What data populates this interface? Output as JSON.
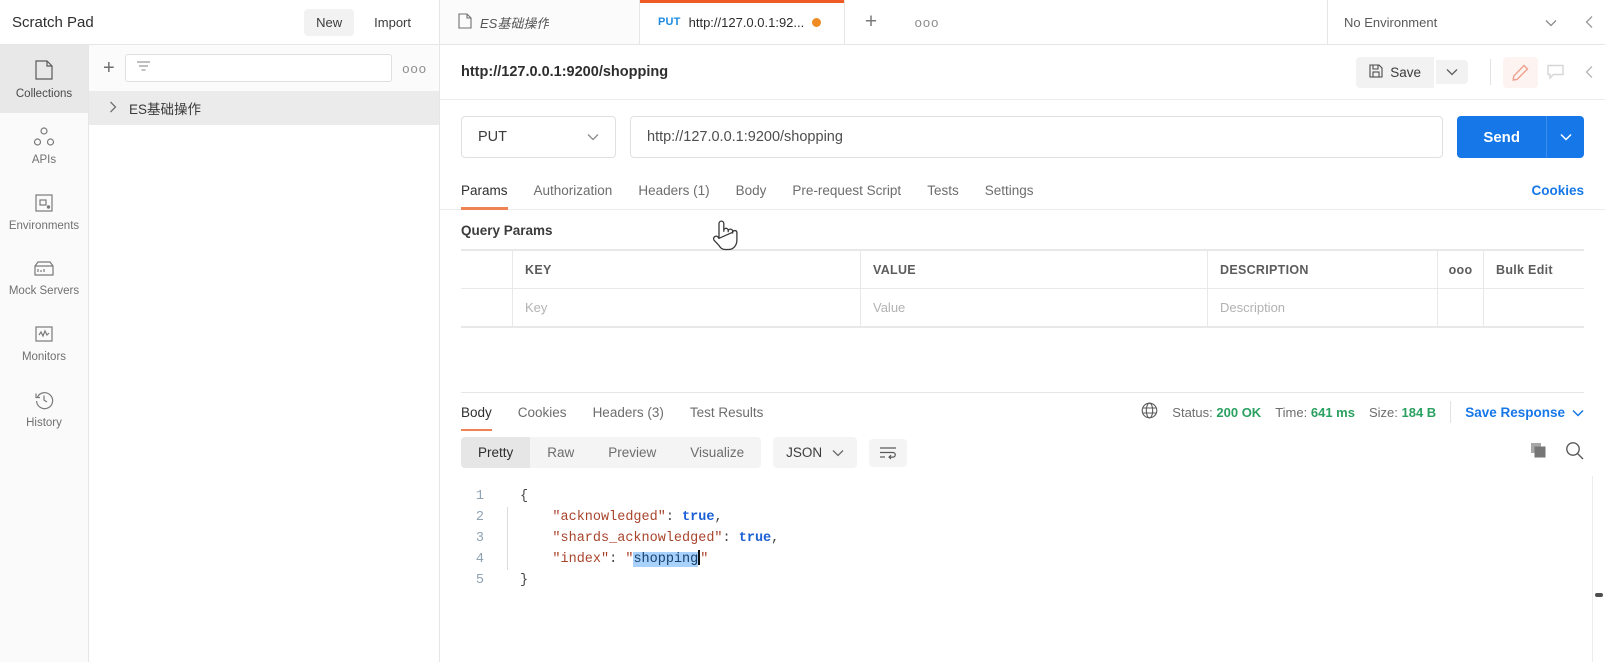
{
  "topbar": {
    "workspace_title": "Scratch Pad",
    "new_label": "New",
    "import_label": "Import",
    "environment_label": "No Environment",
    "tabs": [
      {
        "icon": "request-doc-icon",
        "label": "ES基础操作",
        "active": false
      },
      {
        "method": "PUT",
        "label": "http://127.0.0.1:92...",
        "active": true,
        "unsaved": true
      }
    ],
    "new_tab_label": "+",
    "tab_overflow_label": "ooo"
  },
  "rail": {
    "items": [
      {
        "icon": "collections-icon",
        "label": "Collections"
      },
      {
        "icon": "apis-icon",
        "label": "APIs"
      },
      {
        "icon": "environments-icon",
        "label": "Environments"
      },
      {
        "icon": "mock-servers-icon",
        "label": "Mock Servers"
      },
      {
        "icon": "monitors-icon",
        "label": "Monitors"
      },
      {
        "icon": "history-icon",
        "label": "History"
      }
    ]
  },
  "collections": {
    "add_label": "+",
    "filter_placeholder": "",
    "more_label": "ooo",
    "items": [
      {
        "label": "ES基础操作",
        "expanded": false
      }
    ]
  },
  "request": {
    "name": "http://127.0.0.1:9200/shopping",
    "save_label": "Save",
    "method": "PUT",
    "url": "http://127.0.0.1:9200/shopping",
    "send_label": "Send",
    "tabs": [
      {
        "label": "Params",
        "active": true
      },
      {
        "label": "Authorization",
        "active": false
      },
      {
        "label": "Headers (1)",
        "active": false
      },
      {
        "label": "Body",
        "active": false
      },
      {
        "label": "Pre-request Script",
        "active": false
      },
      {
        "label": "Tests",
        "active": false
      },
      {
        "label": "Settings",
        "active": false
      }
    ],
    "cookies_label": "Cookies",
    "query_params_title": "Query Params",
    "table": {
      "headers": [
        "KEY",
        "VALUE",
        "DESCRIPTION"
      ],
      "bulk_edit_label": "Bulk Edit",
      "more_label": "ooo",
      "rows": [
        {
          "key": "Key",
          "value": "Value",
          "description": "Description"
        }
      ]
    }
  },
  "response": {
    "tabs": [
      {
        "label": "Body",
        "active": true
      },
      {
        "label": "Cookies",
        "active": false
      },
      {
        "label": "Headers (3)",
        "active": false
      },
      {
        "label": "Test Results",
        "active": false
      }
    ],
    "status_label": "Status:",
    "status_value": "200 OK",
    "time_label": "Time:",
    "time_value": "641 ms",
    "size_label": "Size:",
    "size_value": "184 B",
    "save_response_label": "Save Response",
    "view_modes": [
      {
        "label": "Pretty",
        "active": true
      },
      {
        "label": "Raw",
        "active": false
      },
      {
        "label": "Preview",
        "active": false
      },
      {
        "label": "Visualize",
        "active": false
      }
    ],
    "format": "JSON",
    "body_lines": [
      {
        "n": "1",
        "segments": [
          {
            "t": "{",
            "cls": "p"
          }
        ]
      },
      {
        "n": "2",
        "indent": true,
        "segments": [
          {
            "t": "\"acknowledged\"",
            "cls": "k"
          },
          {
            "t": ": ",
            "cls": "p"
          },
          {
            "t": "true",
            "cls": "bool"
          },
          {
            "t": ",",
            "cls": "p"
          }
        ]
      },
      {
        "n": "3",
        "indent": true,
        "segments": [
          {
            "t": "\"shards_acknowledged\"",
            "cls": "k"
          },
          {
            "t": ": ",
            "cls": "p"
          },
          {
            "t": "true",
            "cls": "bool"
          },
          {
            "t": ",",
            "cls": "p"
          }
        ]
      },
      {
        "n": "4",
        "indent": true,
        "segments": [
          {
            "t": "\"index\"",
            "cls": "k"
          },
          {
            "t": ": ",
            "cls": "p"
          },
          {
            "t": "\"",
            "cls": "k"
          },
          {
            "t": "shopping",
            "cls": "sel"
          },
          {
            "t": "\"",
            "cls": "k"
          }
        ]
      },
      {
        "n": "5",
        "segments": [
          {
            "t": "}",
            "cls": "p"
          }
        ]
      }
    ]
  },
  "colors": {
    "accent_orange": "#ef5b25",
    "send_blue": "#1677e8",
    "link_blue": "#1677e8",
    "status_green": "#2aa160",
    "method_blue": "#1d8ce0",
    "selection_blue": "#a8d1fb"
  }
}
